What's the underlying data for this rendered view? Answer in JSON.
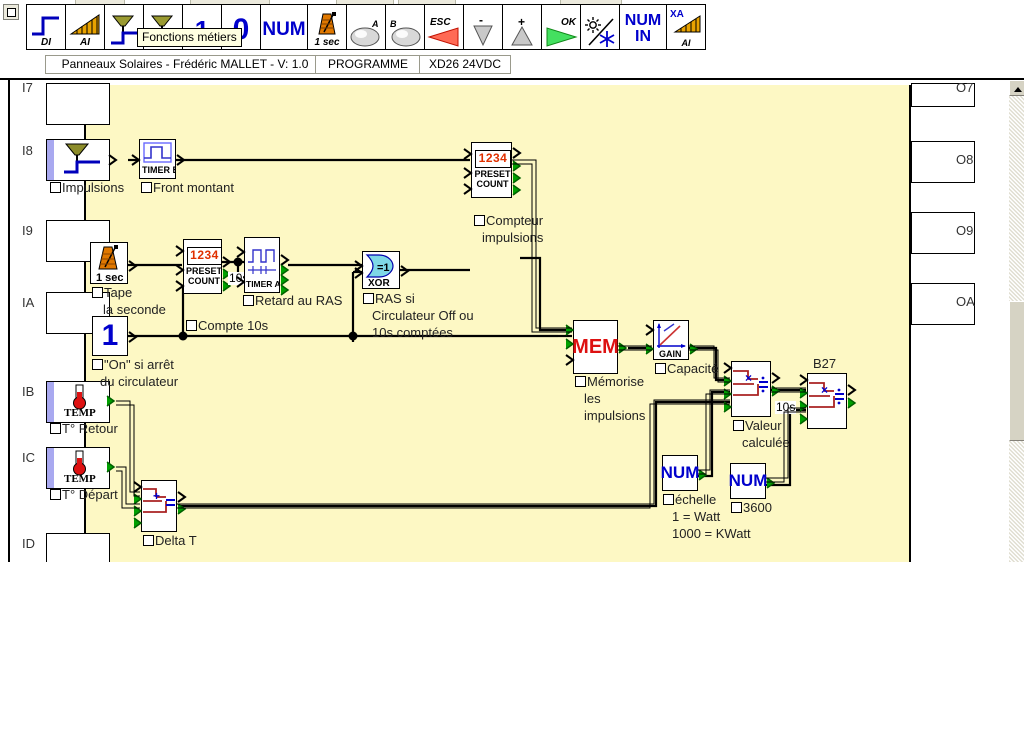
{
  "window": {
    "tooltip": "Fonctions métiers"
  },
  "toolbar": {
    "items": [
      {
        "name": "digital-input-tool",
        "label": "DI"
      },
      {
        "name": "analog-input-tool",
        "label": "AI"
      },
      {
        "name": "filter-input-tool",
        "label": ""
      },
      {
        "name": "business-functions-tool",
        "label": ""
      },
      {
        "name": "constant-one-tool",
        "label": "1"
      },
      {
        "name": "constant-zero-tool",
        "label": "0"
      },
      {
        "name": "num-tool",
        "label": "NUM"
      },
      {
        "name": "timer-1sec-tool",
        "label": "1 sec"
      },
      {
        "name": "button-a-tool",
        "label": "A"
      },
      {
        "name": "button-b-tool",
        "label": "B"
      },
      {
        "name": "esc-key-tool",
        "label": "ESC"
      },
      {
        "name": "down-key-tool",
        "label": "-"
      },
      {
        "name": "up-key-tool",
        "label": "+"
      },
      {
        "name": "ok-key-tool",
        "label": "OK"
      },
      {
        "name": "day-night-tool",
        "label": ""
      },
      {
        "name": "num-in-tool",
        "label": "NUM IN"
      },
      {
        "name": "xa-ai-tool",
        "label": "XA AI"
      }
    ]
  },
  "chips": [
    {
      "name": "program-title-chip",
      "label": "Panneaux Solaires - Frédéric MALLET - V: 1.0"
    },
    {
      "name": "program-mode-chip",
      "label": "PROGRAMME"
    },
    {
      "name": "device-model-chip",
      "label": "XD26 24VDC"
    }
  ],
  "inputs": [
    {
      "name": "input-slot-i7",
      "label": "I7",
      "comment": "",
      "type": "empty"
    },
    {
      "name": "input-slot-i8",
      "label": "I8",
      "comment": "Impulsions",
      "type": "filter"
    },
    {
      "name": "input-slot-i9",
      "label": "I9",
      "comment": "",
      "type": "empty"
    },
    {
      "name": "input-slot-ia",
      "label": "IA",
      "comment": "",
      "type": "empty"
    },
    {
      "name": "input-slot-ib",
      "label": "IB",
      "comment": "T° Retour",
      "type": "temp"
    },
    {
      "name": "input-slot-ic",
      "label": "IC",
      "comment": "T° Départ",
      "type": "temp"
    },
    {
      "name": "input-slot-id",
      "label": "ID",
      "comment": "",
      "type": "empty"
    }
  ],
  "outputs": [
    {
      "name": "output-slot-o7",
      "label": "O7"
    },
    {
      "name": "output-slot-o8",
      "label": "O8"
    },
    {
      "name": "output-slot-o9",
      "label": "O9"
    },
    {
      "name": "output-slot-oa",
      "label": "OA"
    }
  ],
  "blocks": {
    "front_montant": {
      "name": "block-timer-bw-front-montant",
      "glyph": "TIMER BW",
      "comment": "Front montant"
    },
    "tape_seconde": {
      "name": "block-clock-1sec",
      "glyph": "1 sec",
      "comment": "Tape",
      "comment2": "la seconde"
    },
    "on_arret": {
      "name": "block-constant-one",
      "glyph": "1",
      "comment": "\"On\" si arrêt",
      "comment2": "du circulateur"
    },
    "compte_10s": {
      "name": "block-preset-count-compte-10s",
      "glyph_top": "1234",
      "glyph_mid": "PRESET",
      "glyph_bot": "COUNT",
      "comment": "Compte 10s",
      "tag": "10s"
    },
    "retard_ras": {
      "name": "block-timer-ac-retard-au-ras",
      "glyph": "TIMER A-C",
      "comment": "Retard au RAS"
    },
    "ras_si": {
      "name": "block-xor-ras",
      "glyph": "XOR",
      "glyph_sym": "=1",
      "comment": "RAS si",
      "comment2": "Circulateur Off ou",
      "comment3": "10s comptées"
    },
    "compteur_impulsions": {
      "name": "block-preset-count-compteur-impulsions",
      "glyph_top": "1234",
      "glyph_mid": "PRESET",
      "glyph_bot": "COUNT",
      "comment": "Compteur",
      "comment2": "impulsions"
    },
    "memorise": {
      "name": "block-mem-memorise",
      "glyph": "MEM",
      "comment": "Mémorise",
      "comment2": "les",
      "comment3": "impulsions"
    },
    "capacite": {
      "name": "block-gain-capacite",
      "glyph": "GAIN",
      "comment": "Capacité"
    },
    "valeur_calculee": {
      "name": "block-multiply-divide-valeur-calculee",
      "comment": "Valeur",
      "comment2": "calculée",
      "tag": "10s"
    },
    "b27": {
      "name": "block-multiply-divide-b27",
      "title": "B27"
    },
    "echelle": {
      "name": "block-num-echelle",
      "glyph": "NUM",
      "comment": "échelle",
      "comment2": "1 = Watt",
      "comment3": "1000 = KWatt"
    },
    "num_3600": {
      "name": "block-num-3600",
      "glyph": "NUM",
      "comment": "3600"
    },
    "delta_t": {
      "name": "block-subtract-delta-t",
      "comment": "Delta T"
    }
  },
  "colors": {
    "canvas": "#fdf8c4",
    "accent_red": "#cc0000",
    "accent_blue": "#0000cc",
    "pin_green": "#00a000",
    "orange": "#e06a00"
  }
}
